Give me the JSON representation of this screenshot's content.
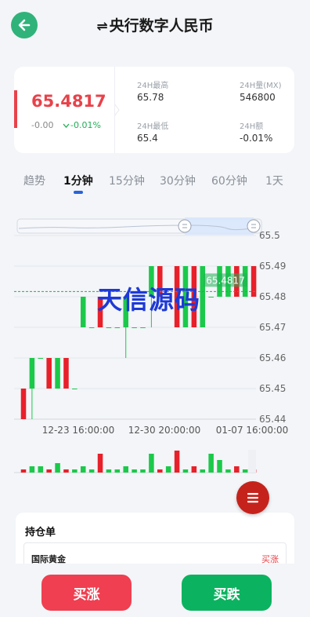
{
  "header": {
    "swap_symbol": "⇌",
    "title": "央行数字人民币",
    "back_color": "#2fb37a"
  },
  "price_card": {
    "price": "65.4817",
    "change": "-0.00",
    "change_pct": "-0.01%",
    "stats": [
      {
        "label": "24H最高",
        "value": "65.78"
      },
      {
        "label": "24H量(MX)",
        "value": "546800"
      },
      {
        "label": "24H最低",
        "value": "65.4"
      },
      {
        "label": "24H额",
        "value": "-0.01%"
      }
    ]
  },
  "tabs": [
    "趋势",
    "1分钟",
    "15分钟",
    "30分钟",
    "60分钟",
    "1天"
  ],
  "active_tab": "1分钟",
  "chart_data": {
    "type": "candlestick",
    "y_ticks": [
      "65.5",
      "65.49",
      "65.48",
      "65.47",
      "65.46",
      "65.45",
      "65.44"
    ],
    "ylim": [
      65.44,
      65.5
    ],
    "x_ticks": [
      "12-23 16:00:00",
      "12-30 20:00:00",
      "01-07 16:00:00"
    ],
    "last_price_label": "65.4817",
    "last_price": 65.4817,
    "candles": [
      {
        "o": 65.45,
        "c": 65.44,
        "h": 65.45,
        "l": 65.44
      },
      {
        "o": 65.45,
        "c": 65.46,
        "h": 65.46,
        "l": 65.44
      },
      {
        "o": 65.46,
        "c": 65.46,
        "h": 65.46,
        "l": 65.46
      },
      {
        "o": 65.46,
        "c": 65.45,
        "h": 65.46,
        "l": 65.45
      },
      {
        "o": 65.45,
        "c": 65.46,
        "h": 65.46,
        "l": 65.45
      },
      {
        "o": 65.46,
        "c": 65.45,
        "h": 65.46,
        "l": 65.45
      },
      {
        "o": 65.45,
        "c": 65.45,
        "h": 65.45,
        "l": 65.45
      },
      {
        "o": 65.47,
        "c": 65.48,
        "h": 65.48,
        "l": 65.47
      },
      {
        "o": 65.47,
        "c": 65.47,
        "h": 65.47,
        "l": 65.47
      },
      {
        "o": 65.48,
        "c": 65.47,
        "h": 65.48,
        "l": 65.47
      },
      {
        "o": 65.47,
        "c": 65.47,
        "h": 65.47,
        "l": 65.47
      },
      {
        "o": 65.47,
        "c": 65.47,
        "h": 65.47,
        "l": 65.47
      },
      {
        "o": 65.47,
        "c": 65.48,
        "h": 65.48,
        "l": 65.46
      },
      {
        "o": 65.47,
        "c": 65.47,
        "h": 65.47,
        "l": 65.47
      },
      {
        "o": 65.47,
        "c": 65.47,
        "h": 65.47,
        "l": 65.47
      },
      {
        "o": 65.48,
        "c": 65.49,
        "h": 65.49,
        "l": 65.47
      },
      {
        "o": 65.49,
        "c": 65.48,
        "h": 65.49,
        "l": 65.48
      },
      {
        "o": 65.48,
        "c": 65.48,
        "h": 65.48,
        "l": 65.48
      },
      {
        "o": 65.49,
        "c": 65.47,
        "h": 65.49,
        "l": 65.47
      },
      {
        "o": 65.47,
        "c": 65.49,
        "h": 65.49,
        "l": 65.47
      },
      {
        "o": 65.49,
        "c": 65.47,
        "h": 65.49,
        "l": 65.47
      },
      {
        "o": 65.47,
        "c": 65.49,
        "h": 65.49,
        "l": 65.47
      },
      {
        "o": 65.48,
        "c": 65.48,
        "h": 65.48,
        "l": 65.48
      },
      {
        "o": 65.48,
        "c": 65.49,
        "h": 65.49,
        "l": 65.48
      },
      {
        "o": 65.48,
        "c": 65.49,
        "h": 65.49,
        "l": 65.48
      },
      {
        "o": 65.49,
        "c": 65.48,
        "h": 65.49,
        "l": 65.48
      },
      {
        "o": 65.48,
        "c": 65.49,
        "h": 65.49,
        "l": 65.48
      },
      {
        "o": 65.49,
        "c": 65.48,
        "h": 65.49,
        "l": 65.48
      }
    ],
    "volumes": [
      1,
      2,
      2,
      1,
      3,
      1,
      1,
      2,
      1,
      6,
      1,
      1,
      2,
      1,
      1,
      6,
      1,
      2,
      7,
      1,
      2,
      1,
      6,
      4,
      1,
      2,
      1,
      1
    ],
    "up_color": "#1bc94a",
    "down_color": "#e8202a"
  },
  "fab_icon": "menu-icon",
  "holdings": {
    "title": "持仓单",
    "rows": [
      {
        "name": "国际黄金",
        "direction": "买涨"
      }
    ]
  },
  "actions": {
    "buy_up": "买涨",
    "buy_down": "买跌"
  },
  "watermark": "天信源码"
}
